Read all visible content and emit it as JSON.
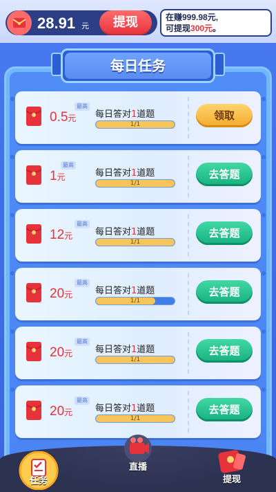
{
  "header": {
    "balance": "28.91",
    "balance_unit": "元",
    "withdraw_label": "提现",
    "earn_line1": "在赚999.98元,",
    "earn_line2_prefix": "可提现",
    "earn_line2_amount": "300元",
    "earn_line2_suffix": "。"
  },
  "title": "每日任务",
  "tasks": [
    {
      "amount": "0.5",
      "unit": "元",
      "badge": "最高",
      "label_pre": "每日答对",
      "label_num": "1",
      "label_post": "道题",
      "progress_text": "1/1",
      "progress": 1.0,
      "action": "领取"
    },
    {
      "amount": "1",
      "unit": "元",
      "badge": "最高",
      "label_pre": "每日答对",
      "label_num": "1",
      "label_post": "道题",
      "progress_text": "1/1",
      "progress": 1.0,
      "action": "去答题"
    },
    {
      "amount": "12",
      "unit": "元",
      "badge": "最高",
      "label_pre": "每日答对",
      "label_num": "1",
      "label_post": "道题",
      "progress_text": "1/1",
      "progress": 1.0,
      "action": "去答题"
    },
    {
      "amount": "20",
      "unit": "元",
      "badge": "最高",
      "label_pre": "每日答对",
      "label_num": "1",
      "label_post": "道题",
      "progress_text": "1/1",
      "progress": 0.75,
      "action": "去答题"
    },
    {
      "amount": "20",
      "unit": "元",
      "badge": "最高",
      "label_pre": "每日答对",
      "label_num": "1",
      "label_post": "道题",
      "progress_text": "1/1",
      "progress": 1.0,
      "action": "去答题"
    },
    {
      "amount": "20",
      "unit": "元",
      "badge": "最高",
      "label_pre": "每日答对",
      "label_num": "1",
      "label_post": "道题",
      "progress_text": "1/1",
      "progress": 1.0,
      "action": "去答题"
    }
  ],
  "nav": {
    "tasks": "任务",
    "live": "直播",
    "withdraw": "提现"
  },
  "colors": {
    "accent_red": "#e6323b",
    "accent_green": "#16b07f",
    "accent_gold": "#f2ab2a",
    "navy": "#2c3f86"
  }
}
